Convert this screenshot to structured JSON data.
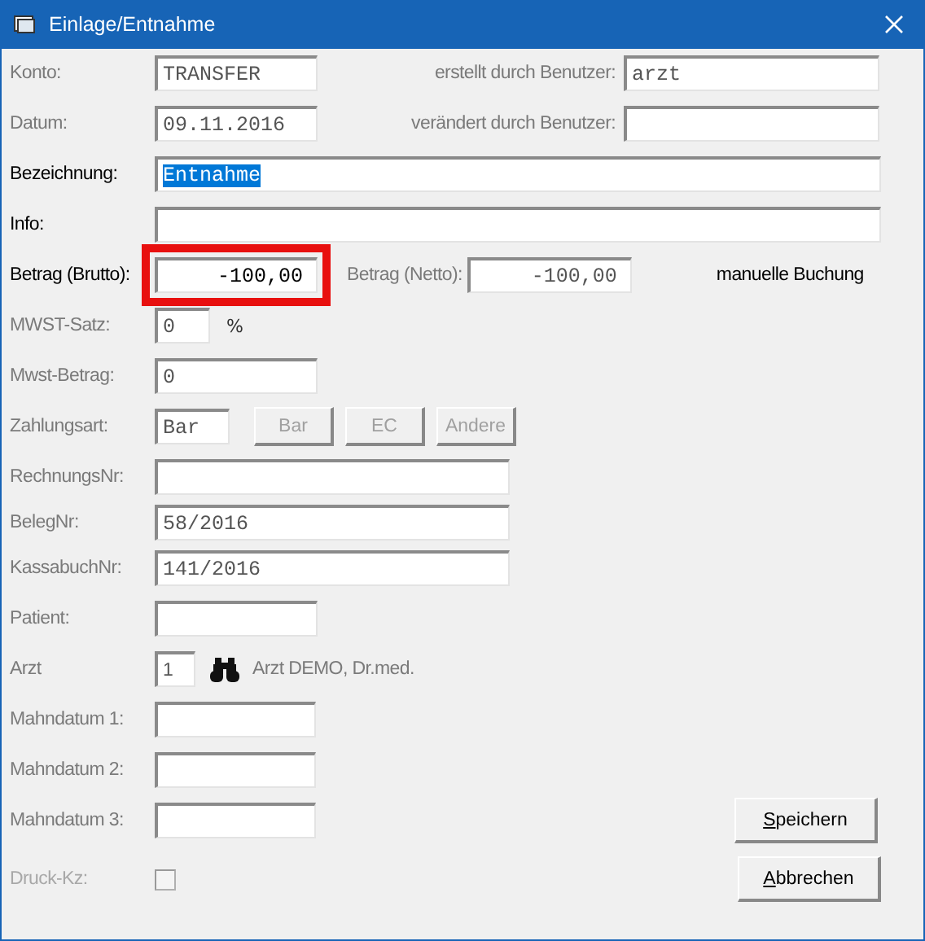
{
  "window": {
    "title": "Einlage/Entnahme"
  },
  "konto": {
    "label": "Konto:",
    "value": "TRANSFER",
    "disabled": true
  },
  "erstellt": {
    "label": "erstellt durch Benutzer:",
    "value": "arzt",
    "disabled": true
  },
  "datum": {
    "label": "Datum:",
    "value": "09.11.2016",
    "disabled": true
  },
  "veraendert": {
    "label": "verändert durch Benutzer:",
    "disabled": true
  },
  "bezeichnung": {
    "label": "Bezeichnung:",
    "value": "Entnahme",
    "disabled": false,
    "text_selected": true
  },
  "info": {
    "label": "Info:",
    "disabled": false
  },
  "betrag_brutto": {
    "label": "Betrag (Brutto):",
    "value": "-100,00",
    "disabled": false,
    "highlighted": true
  },
  "betrag_netto": {
    "label": "Betrag (Netto):",
    "value": "-100,00",
    "disabled": true
  },
  "buchung_note": "manuelle Buchung",
  "mwst_satz": {
    "label": "MWST-Satz:",
    "value": "0",
    "unit": "%",
    "disabled": true
  },
  "mwst_betrag": {
    "label": "Mwst-Betrag:",
    "value": "0",
    "disabled": true
  },
  "zahlungsart": {
    "label": "Zahlungsart:",
    "value": "Bar",
    "disabled": true,
    "buttons": [
      {
        "label": "Bar",
        "disabled": true
      },
      {
        "label": "EC",
        "disabled": true
      },
      {
        "label": "Andere",
        "disabled": true
      }
    ]
  },
  "rechnungs_nr": {
    "label": "RechnungsNr:",
    "disabled": true
  },
  "beleg_nr": {
    "label": "BelegNr:",
    "value": "58/2016",
    "disabled": true
  },
  "kassabuch_nr": {
    "label": "KassabuchNr:",
    "value": "141/2016",
    "disabled": true
  },
  "patient": {
    "label": "Patient:",
    "disabled": true
  },
  "arzt": {
    "label": "Arzt",
    "value": "1",
    "name": "Arzt DEMO, Dr.med.",
    "disabled": true
  },
  "mahndaten": [
    {
      "label": "Mahndatum 1:",
      "disabled": true
    },
    {
      "label": "Mahndatum 2:",
      "disabled": true
    },
    {
      "label": "Mahndatum 3:",
      "disabled": true
    }
  ],
  "druck_kz": {
    "label": "Druck-Kz:",
    "checked": false,
    "disabled": true
  },
  "buttons": [
    {
      "label": "Speichern"
    },
    {
      "label": "Abbrechen"
    }
  ]
}
